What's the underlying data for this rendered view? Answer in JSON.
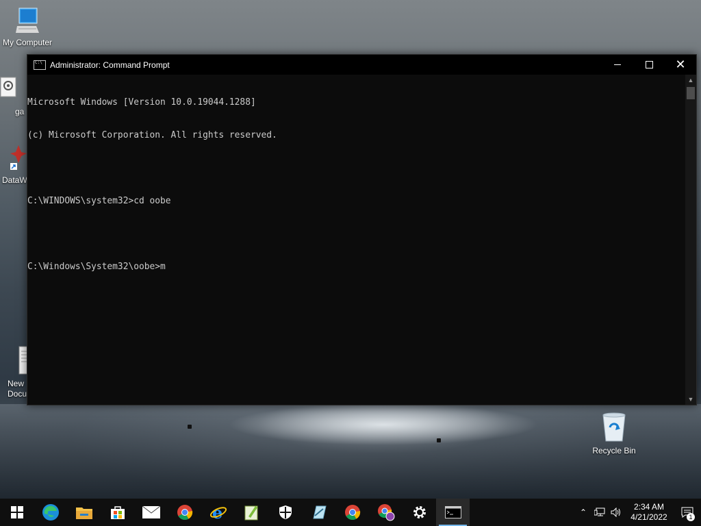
{
  "desktop": {
    "icons": [
      {
        "label": "My Computer",
        "icon": "computer-icon"
      },
      {
        "label": "ga",
        "icon": "gear-document-icon"
      },
      {
        "label": "DataW",
        "icon": "shortcut-app-icon"
      },
      {
        "label": "New\nDocu",
        "icon": "text-document-icon"
      },
      {
        "label": "Recycle Bin",
        "icon": "recycle-bin-icon"
      }
    ]
  },
  "window": {
    "title": "Administrator: Command Prompt",
    "minimize_label": "minimize",
    "maximize_label": "maximize",
    "close_label": "close",
    "lines": [
      "Microsoft Windows [Version 10.0.19044.1288]",
      "(c) Microsoft Corporation. All rights reserved.",
      "",
      "C:\\WINDOWS\\system32>cd oobe",
      "",
      "C:\\Windows\\System32\\oobe>m"
    ]
  },
  "taskbar": {
    "apps": [
      {
        "name": "start",
        "icon": "windows-logo-icon"
      },
      {
        "name": "edge",
        "icon": "edge-icon"
      },
      {
        "name": "file-explorer",
        "icon": "folder-icon"
      },
      {
        "name": "store",
        "icon": "store-icon"
      },
      {
        "name": "mail",
        "icon": "mail-icon"
      },
      {
        "name": "chrome",
        "icon": "chrome-icon"
      },
      {
        "name": "internet-explorer",
        "icon": "ie-icon"
      },
      {
        "name": "notepad-plus",
        "icon": "notepad-icon"
      },
      {
        "name": "defender",
        "icon": "shield-icon"
      },
      {
        "name": "ink",
        "icon": "pen-icon"
      },
      {
        "name": "chrome-2",
        "icon": "chrome-icon"
      },
      {
        "name": "chrome-profile",
        "icon": "chrome-icon"
      },
      {
        "name": "settings",
        "icon": "gear-icon"
      },
      {
        "name": "command-prompt",
        "icon": "cmd-icon"
      }
    ],
    "clock": {
      "time": "2:34 AM",
      "date": "4/21/2022"
    },
    "notification_count": "1"
  },
  "colors": {
    "console_bg": "#0c0c0c",
    "console_text": "#cccccc",
    "taskbar_bg": "#0f0f0f",
    "accent": "#76b9ed"
  }
}
